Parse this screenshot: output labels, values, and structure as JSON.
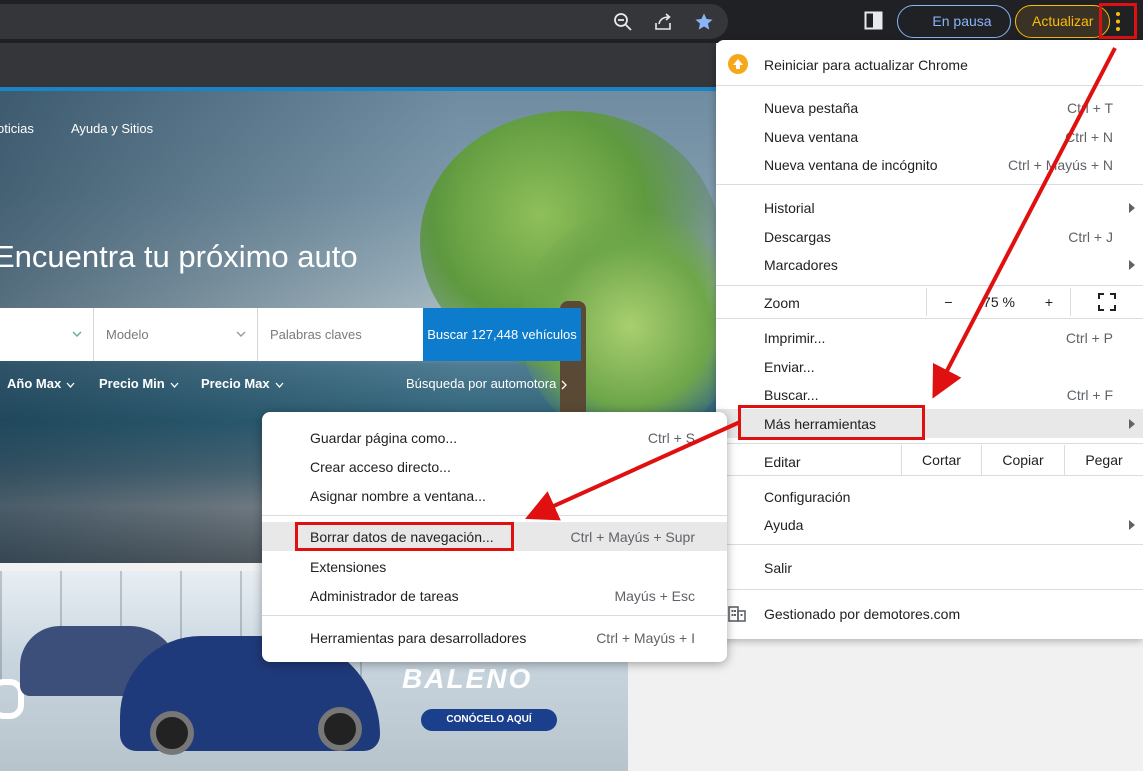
{
  "toolbar": {
    "paused_label": "En pausa",
    "update_label": "Actualizar"
  },
  "site": {
    "nav": [
      "oticias",
      "Ayuda y Sitios"
    ],
    "hero_title": "Encuentra tu próximo auto",
    "search": {
      "model_placeholder": "Modelo",
      "keywords_placeholder": "Palabras claves",
      "button_label": "Buscar 127,448 vehículos"
    },
    "filters": [
      "Año Max",
      "Precio Min",
      "Precio Max"
    ],
    "dealer_search": "Búsqueda por automotora",
    "ad": {
      "model": "BALENO",
      "cta": "CONÓCELO AQUÍ"
    }
  },
  "menu": {
    "update": "Reiniciar para actualizar Chrome",
    "new_tab": {
      "label": "Nueva pestaña",
      "shortcut": "Ctrl + T"
    },
    "new_window": {
      "label": "Nueva ventana",
      "shortcut": "Ctrl + N"
    },
    "incognito": {
      "label": "Nueva ventana de incógnito",
      "shortcut": "Ctrl + Mayús + N"
    },
    "history": {
      "label": "Historial"
    },
    "downloads": {
      "label": "Descargas",
      "shortcut": "Ctrl + J"
    },
    "bookmarks": {
      "label": "Marcadores"
    },
    "zoom": {
      "label": "Zoom",
      "minus": "−",
      "value": "75 %",
      "plus": "+"
    },
    "print": {
      "label": "Imprimir...",
      "shortcut": "Ctrl + P"
    },
    "cast": {
      "label": "Enviar..."
    },
    "find": {
      "label": "Buscar...",
      "shortcut": "Ctrl + F"
    },
    "more_tools": {
      "label": "Más herramientas"
    },
    "edit": {
      "label": "Editar",
      "cut": "Cortar",
      "copy": "Copiar",
      "paste": "Pegar"
    },
    "settings": {
      "label": "Configuración"
    },
    "help": {
      "label": "Ayuda"
    },
    "exit": {
      "label": "Salir"
    },
    "managed": "Gestionado por demotores.com"
  },
  "submenu": {
    "save_page": {
      "label": "Guardar página como...",
      "shortcut": "Ctrl + S"
    },
    "create_shortcut": {
      "label": "Crear acceso directo..."
    },
    "name_window": {
      "label": "Asignar nombre a ventana..."
    },
    "clear_data": {
      "label": "Borrar datos de navegación...",
      "shortcut": "Ctrl + Mayús + Supr"
    },
    "extensions": {
      "label": "Extensiones"
    },
    "task_manager": {
      "label": "Administrador de tareas",
      "shortcut": "Mayús + Esc"
    },
    "dev_tools": {
      "label": "Herramientas para desarrolladores",
      "shortcut": "Ctrl + Mayús + I"
    }
  },
  "colors": {
    "annotation_red": "#e01010",
    "site_blue": "#0d7ccc",
    "update_orange": "#fbbc04",
    "paused_blue": "#8ab4f8"
  }
}
